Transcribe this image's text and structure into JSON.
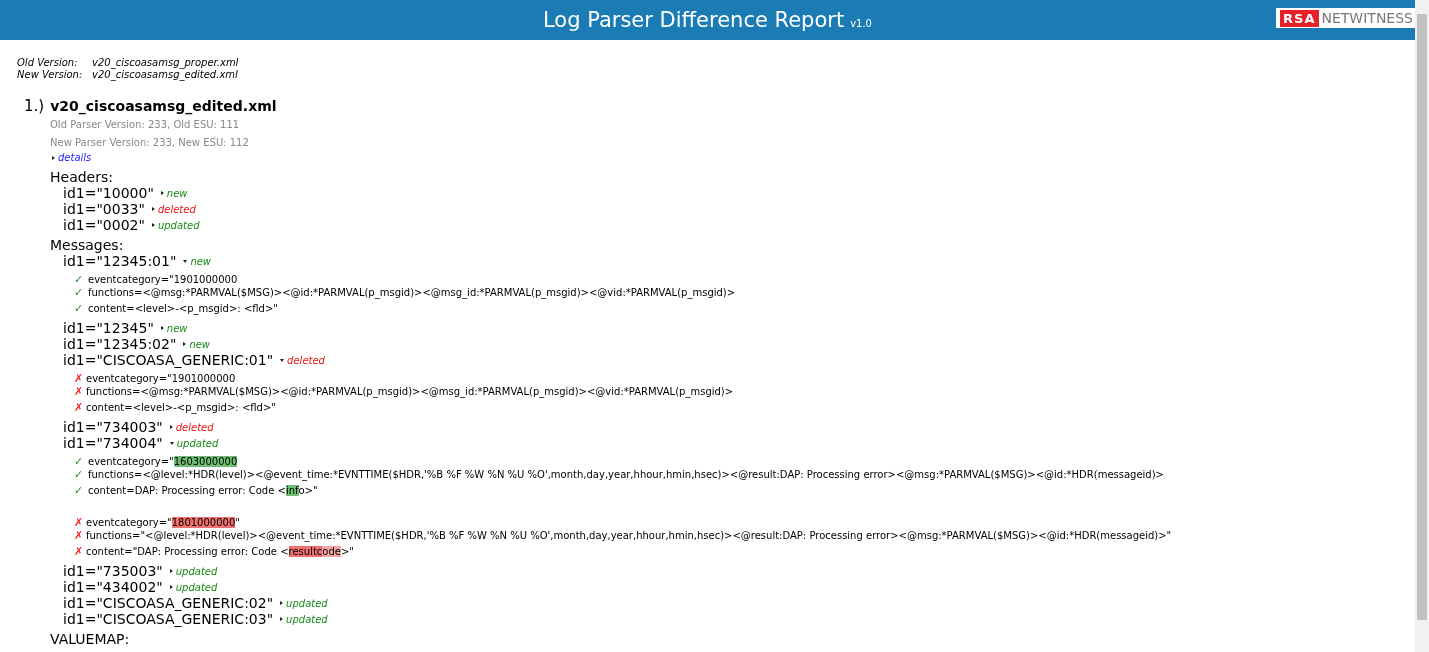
{
  "header": {
    "title": "Log Parser Difference Report",
    "version": "v1.0",
    "logo": {
      "badge": "RSA",
      "name": "NETWITNESS"
    }
  },
  "versions": [
    {
      "label": "Old Version:",
      "file": "v20_ciscoasamsg_proper.xml"
    },
    {
      "label": "New Version:",
      "file": "v20_ciscoasamsg_edited.xml"
    }
  ],
  "report": {
    "number": "1.)",
    "file": "v20_ciscoasamsg_edited.xml",
    "info": [
      "Old Parser Version: 233, Old ESU: 111",
      "New Parser Version: 233, New ESU: 112"
    ],
    "details_toggle": {
      "label": "details",
      "expanded": false
    },
    "sections": [
      {
        "title": "Headers:",
        "items": [
          {
            "id": "id1=\"10000\"",
            "status": "new",
            "kind": "new",
            "expanded": false
          },
          {
            "id": "id1=\"0033\"",
            "status": "deleted",
            "kind": "deleted",
            "expanded": false
          },
          {
            "id": "id1=\"0002\"",
            "status": "updated",
            "kind": "updated",
            "expanded": false
          }
        ]
      },
      {
        "title": "Messages:",
        "items": [
          {
            "id": "id1=\"12345:01\"",
            "status": "new",
            "kind": "new",
            "expanded": true,
            "groups": [
              [
                {
                  "kind": "added",
                  "mark": "✓",
                  "segments": [
                    {
                      "text": "eventcategory=\"1901000000"
                    }
                  ]
                },
                {
                  "kind": "added",
                  "mark": "✓",
                  "segments": [
                    {
                      "text": "functions=<@msg:*PARMVAL($MSG)><@id:*PARMVAL(p_msgid)><@msg_id:*PARMVAL(p_msgid)><@vid:*PARMVAL(p_msgid)>"
                    }
                  ]
                },
                {
                  "kind": "added",
                  "mark": "✓",
                  "segments": [
                    {
                      "text": "content=<level>-<p_msgid>: <fld>\""
                    }
                  ]
                }
              ]
            ]
          },
          {
            "id": "id1=\"12345\"",
            "status": "new",
            "kind": "new",
            "expanded": false
          },
          {
            "id": "id1=\"12345:02\"",
            "status": "new",
            "kind": "new",
            "expanded": false
          },
          {
            "id": "id1=\"CISCOASA_GENERIC:01\"",
            "status": "deleted",
            "kind": "deleted",
            "expanded": true,
            "groups": [
              [
                {
                  "kind": "removed",
                  "mark": "✗",
                  "segments": [
                    {
                      "text": "eventcategory=\"1901000000"
                    }
                  ]
                },
                {
                  "kind": "removed",
                  "mark": "✗",
                  "segments": [
                    {
                      "text": "functions=<@msg:*PARMVAL($MSG)><@id:*PARMVAL(p_msgid)><@msg_id:*PARMVAL(p_msgid)><@vid:*PARMVAL(p_msgid)>"
                    }
                  ]
                },
                {
                  "kind": "removed",
                  "mark": "✗",
                  "segments": [
                    {
                      "text": "content=<level>-<p_msgid>: <fld>\""
                    }
                  ]
                }
              ]
            ]
          },
          {
            "id": "id1=\"734003\"",
            "status": "deleted",
            "kind": "deleted",
            "expanded": false
          },
          {
            "id": "id1=\"734004\"",
            "status": "updated",
            "kind": "updated",
            "expanded": true,
            "groups": [
              [
                {
                  "kind": "added",
                  "mark": "✓",
                  "segments": [
                    {
                      "text": "eventcategory=\""
                    },
                    {
                      "text": "1603000000",
                      "kind": "strong"
                    }
                  ]
                },
                {
                  "kind": "added",
                  "mark": "✓",
                  "segments": [
                    {
                      "text": "functions=<@level:*HDR(level)><@event_time:*EVNTTIME($HDR,'%B %F %W %N %U %O',month,day,year,hhour,hmin,hsec)><@result:DAP: Processing error><@msg:*PARMVAL($MSG)><@id:*HDR(messageid)>"
                    }
                  ]
                },
                {
                  "kind": "added",
                  "mark": "✓",
                  "segments": [
                    {
                      "text": "content=DAP: Processing error: Code <"
                    },
                    {
                      "text": "inf",
                      "kind": "strong"
                    },
                    {
                      "text": "o>\""
                    }
                  ]
                }
              ],
              [
                {
                  "kind": "removed",
                  "mark": "✗",
                  "segments": [
                    {
                      "text": "eventcategory=\""
                    },
                    {
                      "text": "1801000000",
                      "kind": "strong"
                    },
                    {
                      "text": "\""
                    }
                  ]
                },
                {
                  "kind": "removed",
                  "mark": "✗",
                  "segments": [
                    {
                      "text": "functions=\"<@level:*HDR(level)><@event_time:*EVNTTIME($HDR,'%B %F %W %N %U %O',month,day,year,hhour,hmin,hsec)><@result:DAP: Processing error><@msg:*PARMVAL($MSG)><@id:*HDR(messageid)>\""
                    }
                  ]
                },
                {
                  "kind": "removed",
                  "mark": "✗",
                  "segments": [
                    {
                      "text": "content=\"DAP: Processing error: Code <"
                    },
                    {
                      "text": "resultc",
                      "kind": "strong"
                    },
                    {
                      "text": "ode",
                      "kind": "light"
                    },
                    {
                      "text": ">\""
                    }
                  ]
                }
              ]
            ]
          },
          {
            "id": "id1=\"735003\"",
            "status": "updated",
            "kind": "updated",
            "expanded": false
          },
          {
            "id": "id1=\"434002\"",
            "status": "updated",
            "kind": "updated",
            "expanded": false
          },
          {
            "id": "id1=\"CISCOASA_GENERIC:02\"",
            "status": "updated",
            "kind": "updated",
            "expanded": false
          },
          {
            "id": "id1=\"CISCOASA_GENERIC:03\"",
            "status": "updated",
            "kind": "updated",
            "expanded": false
          }
        ]
      },
      {
        "title": "VALUEMAP:"
      }
    ]
  }
}
